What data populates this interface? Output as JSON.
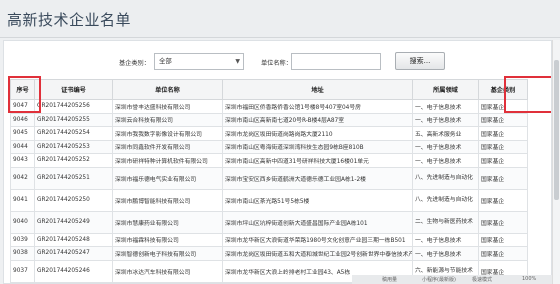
{
  "header": {
    "title": "高新技术企业名单"
  },
  "search": {
    "category_label": "基企类别：",
    "category_value": "全部",
    "name_label": "单位名称：",
    "name_value": "",
    "search_button": "搜索..."
  },
  "table": {
    "columns": [
      "序号",
      "证书编号",
      "单位名称",
      "地址",
      "所属领域",
      "基企类别"
    ],
    "rows": [
      {
        "no": "9047",
        "cert": "GR201744205256",
        "name": "深圳市誉丰达盛科技有限公司",
        "addr": "深圳市福田区侨香路侨香公馆1号楼8号407室04号房",
        "field": "一、电子信息技术",
        "type": "国家基企"
      },
      {
        "no": "9046",
        "cert": "GR201744205255",
        "name": "深圳云合科技有限公司",
        "addr": "深圳市南山区高新南七道20号R-B楼4层A87室",
        "field": "一、电子信息技术",
        "type": "国家基企"
      },
      {
        "no": "9045",
        "cert": "GR201744205254",
        "name": "深圳市我我数字影像设计有限公司",
        "addr": "深圳市龙岗区坂田街道岗路岗路大厦2110",
        "field": "五、高新术服务业",
        "type": "国家基企"
      },
      {
        "no": "9044",
        "cert": "GR201744205253",
        "name": "深圳市同鑫软件开发有限公司",
        "addr": "深圳市南山区粤海街道深圳湾科技生态园9栋B座810B",
        "field": "一、电子信息技术",
        "type": "国家基企"
      },
      {
        "no": "9043",
        "cert": "GR201744205252",
        "name": "深圳市研祥特种计算机软件有限公司",
        "addr": "深圳市南山区高新中四道31号研祥科技大厦16楼01单元",
        "field": "一、电子信息技术",
        "type": "国家基企"
      },
      {
        "no": "9042",
        "cert": "GR201744205251",
        "name": "深圳市福乐德电气实业有限公司",
        "addr": "深圳市宝安区西乡街道鹤洲大道德乐德工业园A栋1-2楼",
        "field": "八、先进制造与自动化",
        "type": "国家基企"
      },
      {
        "no": "9041",
        "cert": "GR201744205250",
        "name": "深圳市鹏博智能科技有限公司",
        "addr": "深圳市南山区茶光路51号5栋5楼",
        "field": "八、先进制造与自动化",
        "type": "国家基企"
      },
      {
        "no": "9040",
        "cert": "GR201744205249",
        "name": "深圳市慧康药业有限公司",
        "addr": "深圳市坪山区坑梓街道创新大道盛昌国际产业园A栋101",
        "field": "二、生物与新医药技术",
        "type": "国家基企"
      },
      {
        "no": "9039",
        "cert": "GR201744205248",
        "name": "深圳市福霖科技有限公司",
        "addr": "深圳市龙华新区大浪街道华荣路1980号文化创意产业园三期一栋B501",
        "field": "一、电子信息技术",
        "type": "国家基企"
      },
      {
        "no": "9038",
        "cert": "GR201744205247",
        "name": "深圳智德创新电子科技有限公司",
        "addr": "深圳市龙岗区坂田街道五和大道和城世纪工业园2号创新世界中泰信技术产业园A1栋1楼",
        "field": "一、电子信息技术",
        "type": "国家基企"
      },
      {
        "no": "9037",
        "cert": "GR201744205246",
        "name": "深圳市冰达汽车科技有限公司",
        "addr": "深圳市龙华新区大浪上岭排老村工业园43、A5栋",
        "field": "六、新能源与节能技术",
        "type": "国家基企"
      }
    ]
  },
  "bottom": {
    "item1": "稿用量",
    "item2": "小程序(最新版)",
    "item3": "极速模式",
    "zoom": "100%"
  }
}
